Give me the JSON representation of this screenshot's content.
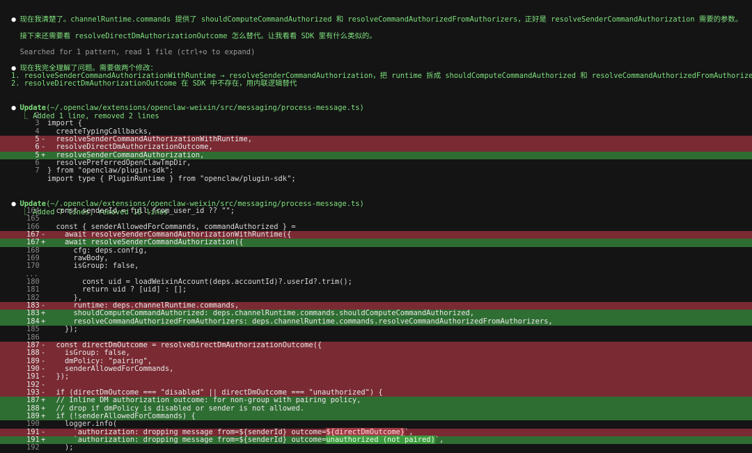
{
  "messages": [
    {
      "bullet": "●",
      "text": "现在我清楚了。channelRuntime.commands 提供了 shouldComputeCommandAuthorized 和 resolveCommandAuthorizedFromAuthorizers，正好是 resolveSenderCommandAuthorization 需要的参数。"
    },
    {
      "text": "接下来还需要看 resolveDirectDmAuthorizationOutcome 怎么替代。让我看看 SDK 里有什么类似的。"
    },
    {
      "text": "Searched for 1 pattern, read 1 file (ctrl+o to expand)"
    },
    {
      "bullet": "●",
      "text": "现在我完全理解了问题。需要做两个修改："
    }
  ],
  "plan": [
    "1. resolveSenderCommandAuthorizationWithRuntime → resolveSenderCommandAuthorization，把 runtime 拆成 shouldComputeCommandAuthorized 和 resolveCommandAuthorizedFromAuthorizers",
    "2. resolveDirectDmAuthorizationOutcome 在 SDK 中不存在，用内联逻辑替代"
  ],
  "updates": [
    {
      "bullet": "●",
      "label": "Update",
      "path": "(~/.openclaw/extensions/openclaw-weixin/src/messaging/process-message.ts)",
      "summary": "Added 1 line, removed 2 lines",
      "corner": "⎿",
      "lines": [
        {
          "t": "ctx",
          "n": "2",
          "s": "",
          "c": ""
        },
        {
          "t": "ctx",
          "n": "3",
          "s": "",
          "c": "import {"
        },
        {
          "t": "ctx",
          "n": "4",
          "s": "",
          "c": "  createTypingCallbacks,"
        },
        {
          "t": "del",
          "n": "5",
          "s": "-",
          "c": "  resolveSenderCommandAuthorizationWithRuntime,"
        },
        {
          "t": "del",
          "n": "6",
          "s": "-",
          "c": "  resolveDirectDmAuthorizationOutcome,"
        },
        {
          "t": "add",
          "n": "5",
          "s": "+",
          "c": "  resolveSenderCommandAuthorization,"
        },
        {
          "t": "ctx",
          "n": "6",
          "s": "",
          "c": "  resolvePreferredOpenClawTmpDir,"
        },
        {
          "t": "ctx",
          "n": "7",
          "s": "",
          "c": "} from \"openclaw/plugin-sdk\";"
        },
        {
          "t": "ctx",
          "n": "",
          "s": "",
          "c": "import type { PluginRuntime } from \"openclaw/plugin-sdk\";"
        }
      ]
    },
    {
      "bullet": "●",
      "label": "Update",
      "path": "(~/.openclaw/extensions/openclaw-weixin/src/messaging/process-message.ts)",
      "summary": "Added 7 lines, removed 10 lines",
      "corner": "⎿",
      "lines": [
        {
          "t": "ctx",
          "n": "164",
          "s": "",
          "c": "  const senderId = full.from_user_id ?? \"\";"
        },
        {
          "t": "ctx",
          "n": "165",
          "s": "",
          "c": ""
        },
        {
          "t": "ctx",
          "n": "166",
          "s": "",
          "c": "  const { senderAllowedForCommands, commandAuthorized } ="
        },
        {
          "t": "del",
          "n": "167",
          "s": "-",
          "c": "    await resolveSenderCommandAuthorizationWithRuntime({"
        },
        {
          "t": "add",
          "n": "167",
          "s": "+",
          "c": "    await resolveSenderCommandAuthorization({"
        },
        {
          "t": "ctx",
          "n": "168",
          "s": "",
          "c": "      cfg: deps.config,"
        },
        {
          "t": "ctx",
          "n": "169",
          "s": "",
          "c": "      rawBody,"
        },
        {
          "t": "ctx",
          "n": "170",
          "s": "",
          "c": "      isGroup: false,"
        },
        {
          "t": "ctx",
          "n": "...",
          "s": "",
          "c": ""
        },
        {
          "t": "ctx",
          "n": "180",
          "s": "",
          "c": "        const uid = loadWeixinAccount(deps.accountId)?.userId?.trim();"
        },
        {
          "t": "ctx",
          "n": "181",
          "s": "",
          "c": "        return uid ? [uid] : [];"
        },
        {
          "t": "ctx",
          "n": "182",
          "s": "",
          "c": "      },"
        },
        {
          "t": "del",
          "n": "183",
          "s": "-",
          "c": "      runtime: deps.channelRuntime.commands,"
        },
        {
          "t": "add",
          "n": "183",
          "s": "+",
          "c": "      shouldComputeCommandAuthorized: deps.channelRuntime.commands.shouldComputeCommandAuthorized,"
        },
        {
          "t": "add",
          "n": "184",
          "s": "+",
          "c": "      resolveCommandAuthorizedFromAuthorizers: deps.channelRuntime.commands.resolveCommandAuthorizedFromAuthorizers,"
        },
        {
          "t": "ctx",
          "n": "185",
          "s": "",
          "c": "    });"
        },
        {
          "t": "ctx",
          "n": "186",
          "s": "",
          "c": ""
        },
        {
          "t": "del",
          "n": "187",
          "s": "-",
          "c": "  const directDmOutcome = resolveDirectDmAuthorizationOutcome({"
        },
        {
          "t": "del",
          "n": "188",
          "s": "-",
          "c": "    isGroup: false,"
        },
        {
          "t": "del",
          "n": "189",
          "s": "-",
          "c": "    dmPolicy: \"pairing\","
        },
        {
          "t": "del",
          "n": "190",
          "s": "-",
          "c": "    senderAllowedForCommands,"
        },
        {
          "t": "del",
          "n": "191",
          "s": "-",
          "c": "  });"
        },
        {
          "t": "del",
          "n": "192",
          "s": "-",
          "c": ""
        },
        {
          "t": "del",
          "n": "193",
          "s": "-",
          "c": "  if (directDmOutcome === \"disabled\" || directDmOutcome === \"unauthorized\") {"
        },
        {
          "t": "add",
          "n": "187",
          "s": "+",
          "c": "  // Inline DM authorization outcome: for non-group with pairing policy,"
        },
        {
          "t": "add",
          "n": "188",
          "s": "+",
          "c": "  // drop if dmPolicy is disabled or sender is not allowed."
        },
        {
          "t": "add",
          "n": "189",
          "s": "+",
          "c": "  if (!senderAllowedForCommands) {"
        },
        {
          "t": "ctx",
          "n": "190",
          "s": "",
          "c": "    logger.info("
        },
        {
          "t": "del",
          "n": "191",
          "s": "-",
          "c": "      `authorization: dropping message from=${senderId} outcome=",
          "h": "${directDmOutcome}",
          "e": "`,"
        },
        {
          "t": "add",
          "n": "191",
          "s": "+",
          "c": "      `authorization: dropping message from=${senderId} outcome=",
          "h": "unauthorized (not paired)",
          "e": "`,"
        },
        {
          "t": "ctx",
          "n": "192",
          "s": "",
          "c": "    );"
        }
      ]
    }
  ]
}
